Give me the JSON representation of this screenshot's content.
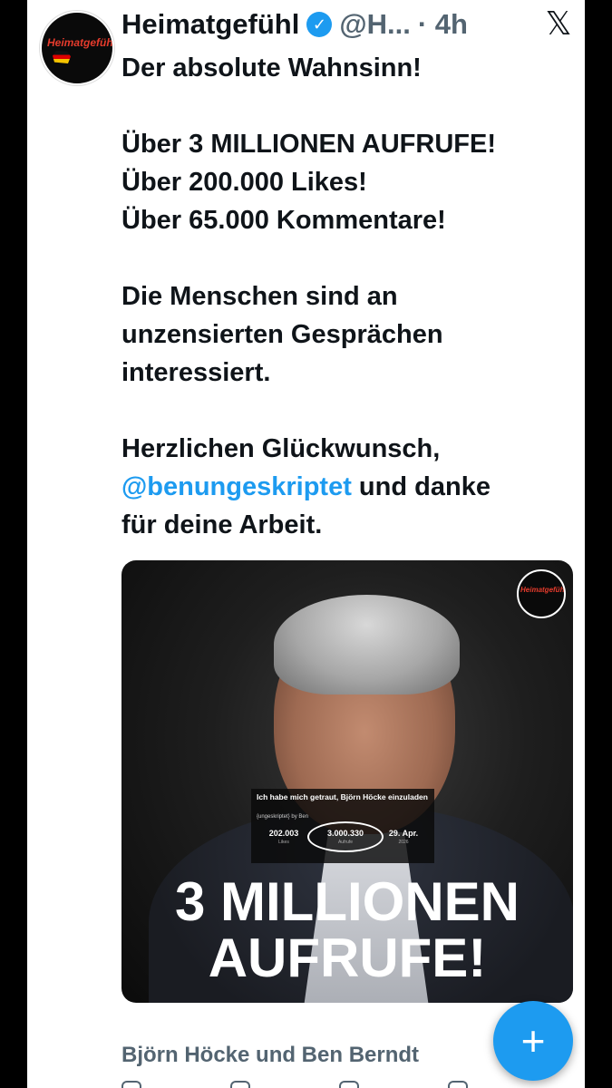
{
  "tweet": {
    "author": {
      "name": "Heimatgefühl",
      "handle": "@H...",
      "time": "· 4h",
      "avatar_label": "Heimatgefühl",
      "verified_icon": "verified-badge-icon"
    },
    "close_icon": "𝕏",
    "lines": {
      "l1": "Der absolute Wahnsinn!",
      "l2": "Über 3 MILLIONEN AUFRUFE!",
      "l3": "Über 200.000 Likes!",
      "l4": "Über 65.000 Kommentare!",
      "l5": "Die Menschen sind an",
      "l6": "unzensierten Gesprächen",
      "l7": "interessiert.",
      "l8": "Herzlichen Glückwunsch,",
      "mention": "@benungeskriptet",
      "l9_rest": " und danke",
      "l10": "für deine Arbeit."
    },
    "media": {
      "logo_label": "Heimatgefühl",
      "overlay": {
        "title": "Ich habe mich getraut, Björn Höcke einzuladen",
        "channel": "{ungeskriptet} by Ben",
        "likes_value": "202.003",
        "likes_label": "Likes",
        "views_value": "3.000.330",
        "views_label": "Aufrufe",
        "date_value": "29. Apr.",
        "date_label": "2026"
      },
      "caption_line1": "3 MILLIONEN",
      "caption_line2": "AUFRUFE!"
    },
    "footer_title": "Björn Höcke und Ben Berndt"
  },
  "compose_button": {
    "icon": "+",
    "icon_name": "plus-icon"
  },
  "colors": {
    "accent": "#1d9bf0",
    "text": "#0f1419",
    "muted": "#536471"
  }
}
